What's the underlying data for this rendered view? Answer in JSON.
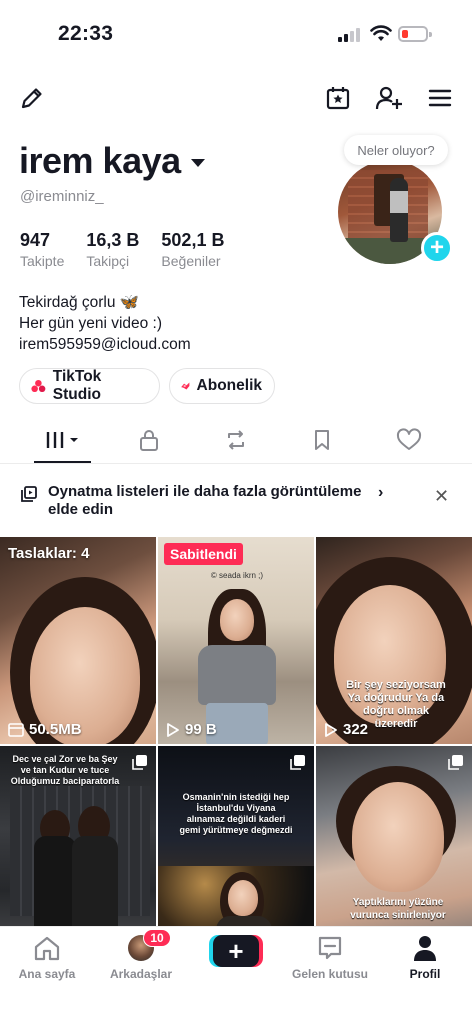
{
  "status_bar": {
    "time": "22:33"
  },
  "profile": {
    "display_name": "irem kaya",
    "username": "@ireminniz_",
    "status_bubble": "Neler oluyor?",
    "stats": [
      {
        "value": "947",
        "label": "Takipte"
      },
      {
        "value": "16,3 B",
        "label": "Takipçi"
      },
      {
        "value": "502,1 B",
        "label": "Beğeniler"
      }
    ],
    "bio": [
      "Tekirdağ çorlu",
      "Her gün yeni video :)",
      "irem595959@icloud.com"
    ],
    "bio_emoji": "🦋",
    "buttons": {
      "studio": "TikTok Studio",
      "subscription": "Abonelik"
    }
  },
  "banner": {
    "text": "Oynatma listeleri ile daha fazla görüntüleme elde edin",
    "chevron": "›",
    "close": "✕"
  },
  "videos": [
    {
      "label": "Taslaklar: 4",
      "footer": "50.5MB"
    },
    {
      "label": "Sabitlendi",
      "footer": "99 B",
      "overlay": "© seada ikrn ;)"
    },
    {
      "footer": "322",
      "overlay": "Bir şey seziyorsam Ya doğrudur Ya da doğru olmak üzeredir"
    },
    {
      "overlay": "Dec ve çal Zor ve ba Şey ve tan Kudur ve tuce Olduğumuz baciparatorla"
    },
    {
      "overlay": "Osmanin'nin istediği hep İstanbul'du Viyana alınamaz değildi kaderi gemi yürütmeye değmezdi"
    },
    {
      "overlay": "Yaptıklarını yüzüne vurunca sinirleniyor"
    }
  ],
  "bottom_nav": {
    "home": "Ana sayfa",
    "friends": "Arkadaşlar",
    "friends_badge": "10",
    "inbox": "Gelen kutusu",
    "profile": "Profil"
  },
  "colors": {
    "accent_pink": "#fe2c55",
    "accent_cyan": "#20d5ec",
    "text": "#161823",
    "muted": "#8a8b91"
  }
}
